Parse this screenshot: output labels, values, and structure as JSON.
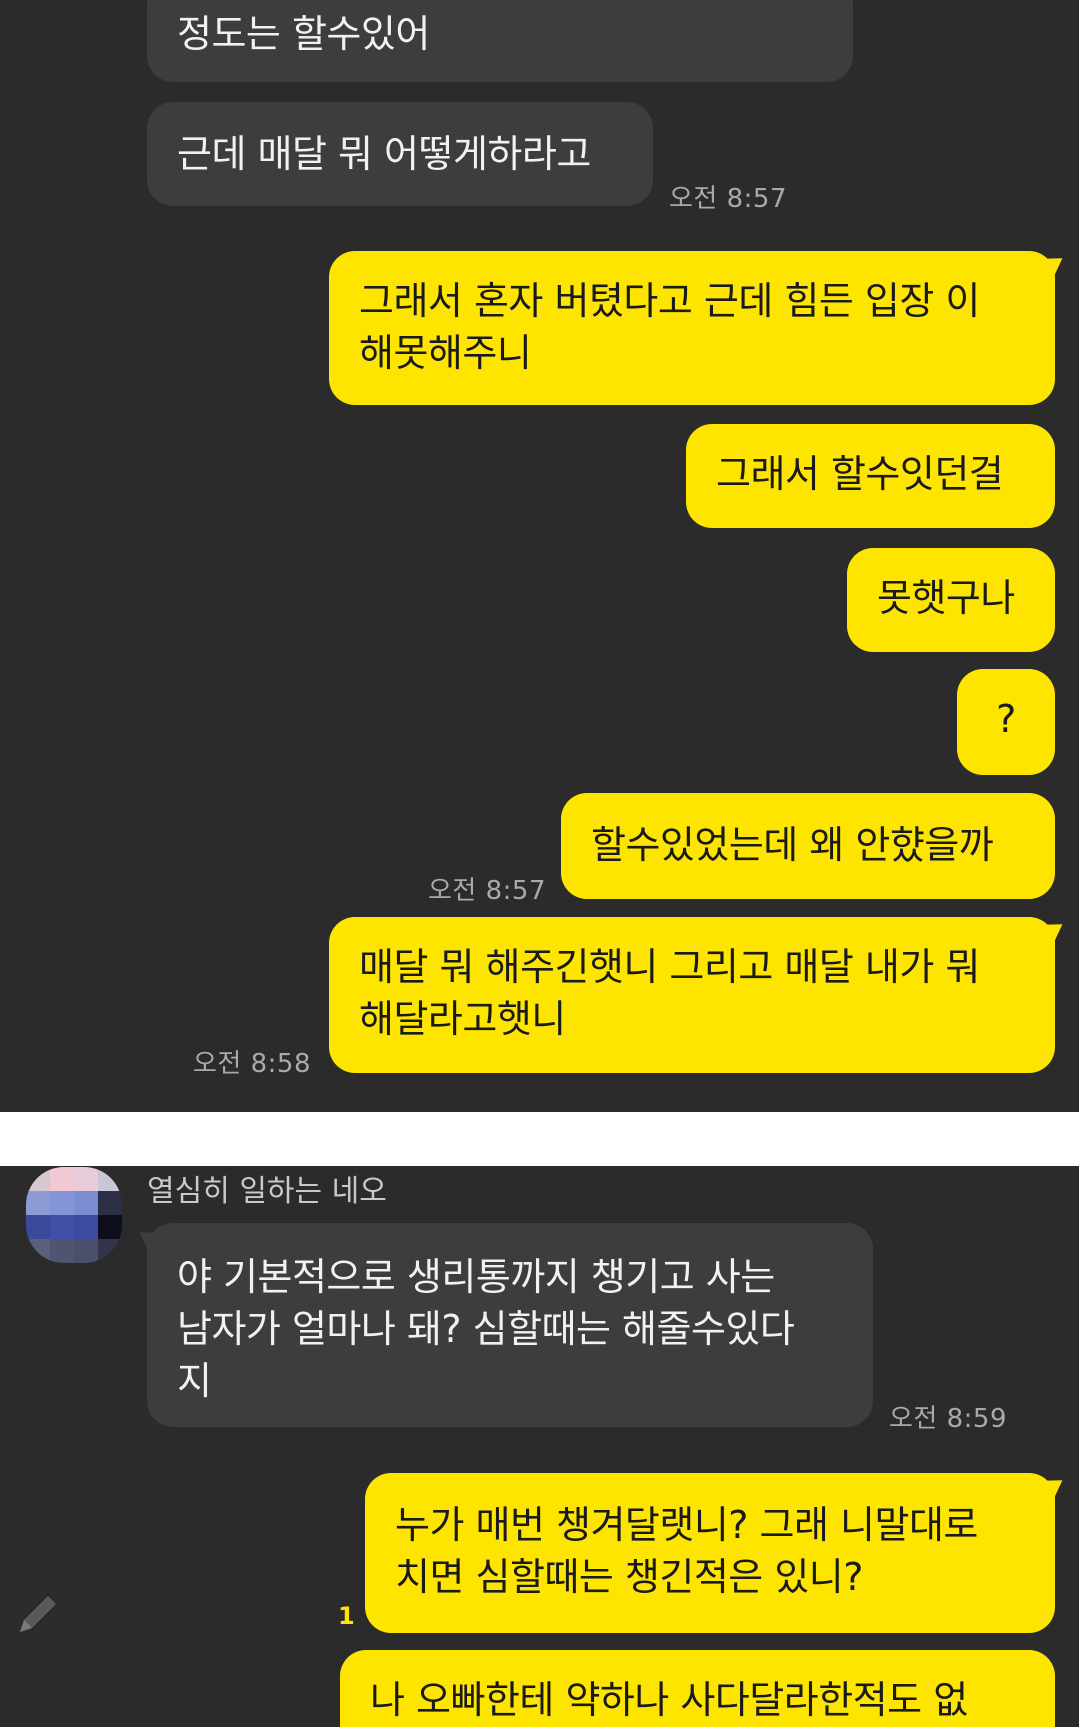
{
  "chat_top": {
    "messages": [
      {
        "text": "정도는 할수있어"
      },
      {
        "text": "근데 매달 뭐 어떻게하라고"
      },
      {
        "text": "그래서 혼자 버텼다고 근데 힘든 입장 이\n해못해주니"
      },
      {
        "text": "그래서 할수잇던걸"
      },
      {
        "text": "못햇구나"
      },
      {
        "text": "?"
      },
      {
        "text": "할수있었는데 왜 안햤을까"
      },
      {
        "text": "매달 뭐 해주긴햇니 그리고 매달 내가 뭐\n해달라고햇니"
      }
    ],
    "times": [
      "오전 8:57",
      "오전 8:57",
      "오전 8:58"
    ]
  },
  "chat_bottom": {
    "sender_name": "열심히 일하는 네오",
    "messages": [
      {
        "text": "야 기본적으로 생리통까지 챙기고 사는\n남자가 얼마나 돼? 심할때는 해줄수있다\n지"
      },
      {
        "text": "누가 매번 챙겨달랫니? 그래 니말대로\n치면 심할때는 챙긴적은 있니?"
      },
      {
        "text": "나 오빠한테 약하나 사다달라한적도 없"
      }
    ],
    "times": [
      "오전 8:59"
    ],
    "unread_count": "1"
  },
  "colors": {
    "background": "#2b2b2b",
    "incoming_bubble": "#3d3d3d",
    "outgoing_bubble": "#fee500",
    "unread": "#fee500",
    "divider": "#ffffff"
  },
  "icons": {
    "compose": "pencil-icon",
    "avatar": "profile-avatar-icon"
  }
}
